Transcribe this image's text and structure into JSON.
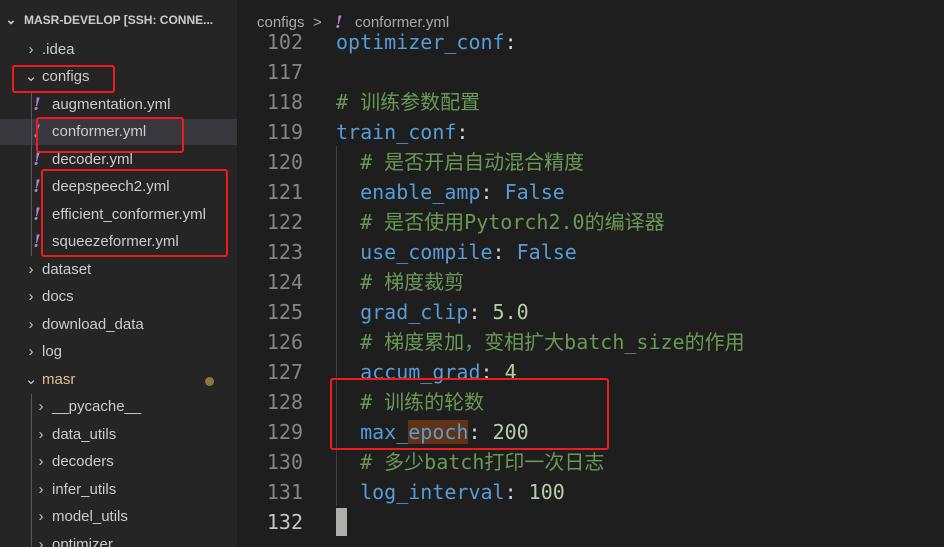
{
  "explorer": {
    "title": "MASR-DEVELOP [SSH: CONNE...",
    "items": [
      {
        "label": ".idea",
        "kind": "folder",
        "expanded": false
      },
      {
        "label": "configs",
        "kind": "folder",
        "expanded": true
      },
      {
        "label": "augmentation.yml",
        "kind": "yaml-file"
      },
      {
        "label": "conformer.yml",
        "kind": "yaml-file",
        "selected": true
      },
      {
        "label": "decoder.yml",
        "kind": "yaml-file"
      },
      {
        "label": "deepspeech2.yml",
        "kind": "yaml-file"
      },
      {
        "label": "efficient_conformer.yml",
        "kind": "yaml-file"
      },
      {
        "label": "squeezeformer.yml",
        "kind": "yaml-file"
      },
      {
        "label": "dataset",
        "kind": "folder",
        "expanded": false
      },
      {
        "label": "docs",
        "kind": "folder",
        "expanded": false
      },
      {
        "label": "download_data",
        "kind": "folder",
        "expanded": false
      },
      {
        "label": "log",
        "kind": "folder",
        "expanded": false
      },
      {
        "label": "masr",
        "kind": "folder",
        "expanded": true,
        "modified": true
      },
      {
        "label": "__pycache__",
        "kind": "folder",
        "expanded": false
      },
      {
        "label": "data_utils",
        "kind": "folder",
        "expanded": false
      },
      {
        "label": "decoders",
        "kind": "folder",
        "expanded": false
      },
      {
        "label": "infer_utils",
        "kind": "folder",
        "expanded": false
      },
      {
        "label": "model_utils",
        "kind": "folder",
        "expanded": false
      },
      {
        "label": "optimizer",
        "kind": "folder",
        "expanded": false
      }
    ]
  },
  "breadcrumb": {
    "folder": "configs",
    "separator": ">",
    "file_icon": "!",
    "file": "conformer.yml"
  },
  "editor": {
    "lines": [
      {
        "num": "102",
        "tokens": [
          {
            "t": "optimizer_conf",
            "c": "key"
          },
          {
            "t": ":",
            "c": "punc"
          }
        ]
      },
      {
        "num": "117",
        "tokens": []
      },
      {
        "num": "118",
        "tokens": [
          {
            "t": "# 训练参数配置",
            "c": "cmt"
          }
        ]
      },
      {
        "num": "119",
        "tokens": [
          {
            "t": "train_conf",
            "c": "key"
          },
          {
            "t": ":",
            "c": "punc"
          }
        ]
      },
      {
        "num": "120",
        "tokens": [
          {
            "t": "  # 是否开启自动混合精度",
            "c": "cmt"
          }
        ]
      },
      {
        "num": "121",
        "tokens": [
          {
            "t": "  enable_amp",
            "c": "key"
          },
          {
            "t": ": ",
            "c": "punc"
          },
          {
            "t": "False",
            "c": "bool"
          }
        ]
      },
      {
        "num": "122",
        "tokens": [
          {
            "t": "  # 是否使用Pytorch2.0的编译器",
            "c": "cmt"
          }
        ]
      },
      {
        "num": "123",
        "tokens": [
          {
            "t": "  use_compile",
            "c": "key"
          },
          {
            "t": ": ",
            "c": "punc"
          },
          {
            "t": "False",
            "c": "bool"
          }
        ]
      },
      {
        "num": "124",
        "tokens": [
          {
            "t": "  # 梯度裁剪",
            "c": "cmt"
          }
        ]
      },
      {
        "num": "125",
        "tokens": [
          {
            "t": "  grad_clip",
            "c": "key"
          },
          {
            "t": ": ",
            "c": "punc"
          },
          {
            "t": "5.0",
            "c": "num"
          }
        ]
      },
      {
        "num": "126",
        "tokens": [
          {
            "t": "  # 梯度累加，变相扩大batch_size的作用",
            "c": "cmt"
          }
        ]
      },
      {
        "num": "127",
        "tokens": [
          {
            "t": "  accum_grad",
            "c": "key"
          },
          {
            "t": ": ",
            "c": "punc"
          },
          {
            "t": "4",
            "c": "num"
          }
        ]
      },
      {
        "num": "128",
        "tokens": [
          {
            "t": "  # 训练的轮数",
            "c": "cmt"
          }
        ]
      },
      {
        "num": "129",
        "tokens": [
          {
            "t": "  max_",
            "c": "key"
          },
          {
            "t": "epoch",
            "c": "key hl"
          },
          {
            "t": ": ",
            "c": "punc"
          },
          {
            "t": "200",
            "c": "num"
          }
        ]
      },
      {
        "num": "130",
        "tokens": [
          {
            "t": "  # 多少batch打印一次日志",
            "c": "cmt"
          }
        ]
      },
      {
        "num": "131",
        "tokens": [
          {
            "t": "  log_interval",
            "c": "key"
          },
          {
            "t": ": ",
            "c": "punc"
          },
          {
            "t": "100",
            "c": "num"
          }
        ]
      },
      {
        "num": "132",
        "tokens": [],
        "active": true
      }
    ]
  },
  "colors": {
    "annotation_red": "#ee1c1c",
    "yaml_icon": "#b180d7",
    "key": "#569cd6",
    "comment": "#6a9955",
    "number": "#b5cea8"
  }
}
